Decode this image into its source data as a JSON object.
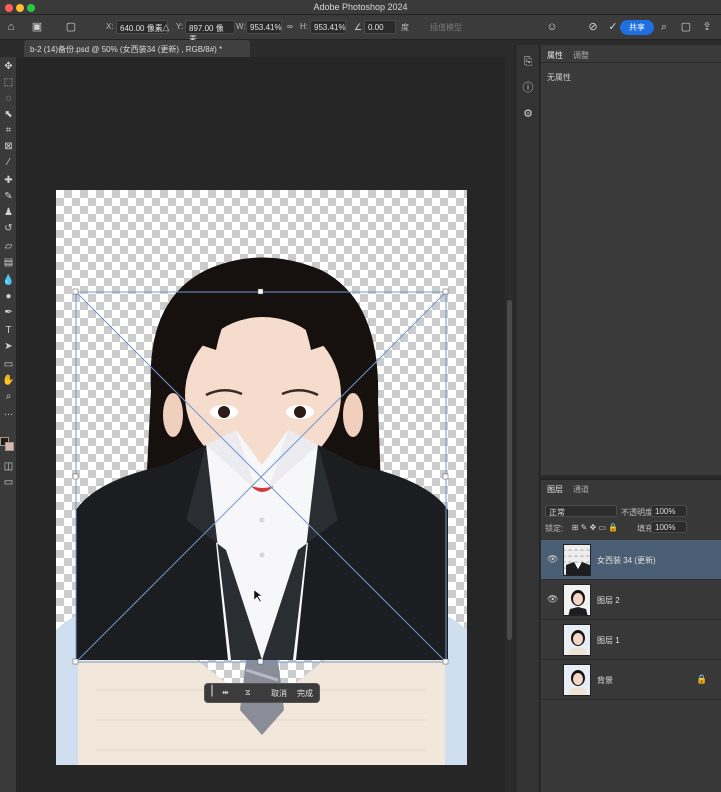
{
  "window": {
    "title": "Adobe Photoshop 2024"
  },
  "options_bar": {
    "x_label": "X:",
    "x_value": "640.00 像素",
    "y_label": "Y:",
    "y_value": "897.00 像素",
    "w_label": "W:",
    "w_value": "953.41%",
    "h_label": "H:",
    "h_value": "953.41%",
    "angle_value": "0.00",
    "angle_unit": "度",
    "interp_label": "插值模型",
    "share_label": "共享"
  },
  "document_tab": {
    "label": "b-2 (14)备份.psd @ 50% (女西装34 (更新) , RGB/8#) *"
  },
  "transform_bar": {
    "cancel_label": "取消",
    "done_label": "完成"
  },
  "properties": {
    "tab_properties": "属性",
    "tab_adjust": "调整",
    "empty_label": "无属性"
  },
  "layers_panel": {
    "tab_layers": "图层",
    "tab_channels": "通道",
    "blend_mode": "正常",
    "opacity_label": "不透明度:",
    "opacity_value": "100%",
    "lock_label": "锁定:",
    "fill_label": "填充:",
    "fill_value": "100%",
    "layers": [
      {
        "name": "女西装 34 (更新)",
        "visible": true,
        "selected": true
      },
      {
        "name": "图层 2",
        "visible": true,
        "selected": false
      },
      {
        "name": "图层 1",
        "visible": false,
        "selected": false
      },
      {
        "name": "背景",
        "visible": false,
        "selected": false,
        "locked": true
      }
    ]
  },
  "colors": {
    "accent": "#1f6fe0",
    "selected_layer": "#4a5f74",
    "guide": "#4a7fc0"
  }
}
